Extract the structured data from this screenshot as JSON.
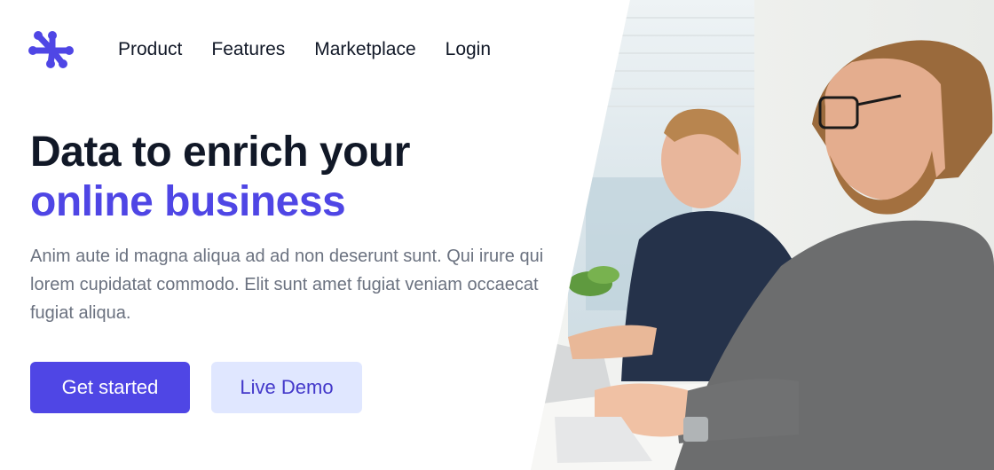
{
  "brand": {
    "logo_icon": "workflow-logo-icon",
    "accent": "#4f46e5"
  },
  "nav": {
    "items": [
      "Product",
      "Features",
      "Marketplace",
      "Login"
    ]
  },
  "hero": {
    "headline_line1": "Data to enrich your",
    "headline_line2": "online business",
    "lead": "Anim aute id magna aliqua ad ad non deserunt sunt. Qui irure qui lorem cupidatat commodo. Elit sunt amet fugiat veniam occaecat fugiat aliqua.",
    "primary_cta": "Get started",
    "secondary_cta": "Live Demo",
    "image": "office-workers-photo"
  }
}
